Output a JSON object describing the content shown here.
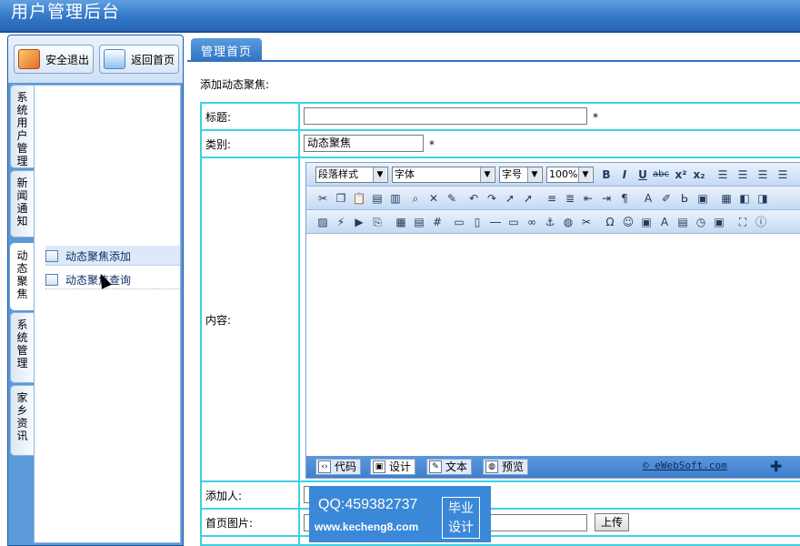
{
  "app": {
    "title": "用户管理后台"
  },
  "toolbar": {
    "logout_label": "安全退出",
    "home_label": "返回首页"
  },
  "sidebar": {
    "tabs": [
      {
        "label": "系统用户管理"
      },
      {
        "label": "新闻通知"
      },
      {
        "label": "动态聚焦"
      },
      {
        "label": "系统管理"
      },
      {
        "label": "家乡资讯"
      }
    ],
    "items": [
      {
        "label": "动态聚焦添加"
      },
      {
        "label": "动态聚焦查询"
      }
    ]
  },
  "main": {
    "tab_label": "管理首页",
    "section_title": "添加动态聚焦:",
    "form": {
      "title_label": "标题:",
      "title_value": "",
      "category_label": "类别:",
      "category_value": "动态聚焦",
      "content_label": "内容:",
      "adder_label": "添加人:",
      "image_label": "首页图片:",
      "upload_label": "上传",
      "required_mark": "*"
    },
    "editor": {
      "format_value": "段落样式",
      "font_value": "字体",
      "size_value": "字号",
      "zoom_value": "100%",
      "modes": [
        {
          "label": "代码"
        },
        {
          "label": "设计"
        },
        {
          "label": "文本"
        },
        {
          "label": "预览"
        }
      ],
      "copyright": "© eWebSoft.com"
    }
  },
  "watermark": {
    "qq": "QQ:459382737",
    "url": "www.kecheng8.com",
    "badge_line1": "毕业",
    "badge_line2": "设计"
  },
  "colors": {
    "accent": "#2f73c0",
    "border": "#3fd0e0"
  }
}
